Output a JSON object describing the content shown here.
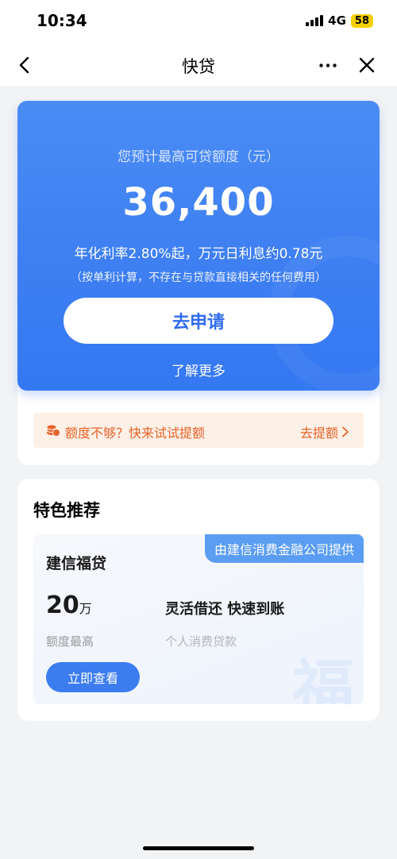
{
  "status": {
    "time": "10:34",
    "network": "4G",
    "battery": "58"
  },
  "nav": {
    "title": "快贷"
  },
  "hero": {
    "label": "您预计最高可贷额度（元）",
    "amount": "36,400",
    "rate": "年化利率2.80%起，万元日利息约0.78元",
    "note": "（按单利计算，不存在与贷款直接相关的任何费用）",
    "apply_button": "去申请",
    "learn_more": "了解更多"
  },
  "quota": {
    "text": "额度不够？快来试试提额",
    "link": "去提额"
  },
  "recommend": {
    "title": "特色推荐",
    "provider": "由建信消费金融公司提供",
    "product_name": "建信福贷",
    "amount_num": "20",
    "amount_unit": "万",
    "amount_label": "额度最高",
    "feature": "灵活借还 快速到账",
    "category": "个人消费贷款",
    "view_button": "立即查看",
    "watermark": "福"
  },
  "colors": {
    "accent": "#3e7ff2",
    "warning": "#e8622a",
    "tag": "#5b9df2"
  },
  "icons": [
    "back-arrow-icon",
    "more-dots-icon",
    "close-icon",
    "coin-stack-icon",
    "chevron-right-icon"
  ]
}
